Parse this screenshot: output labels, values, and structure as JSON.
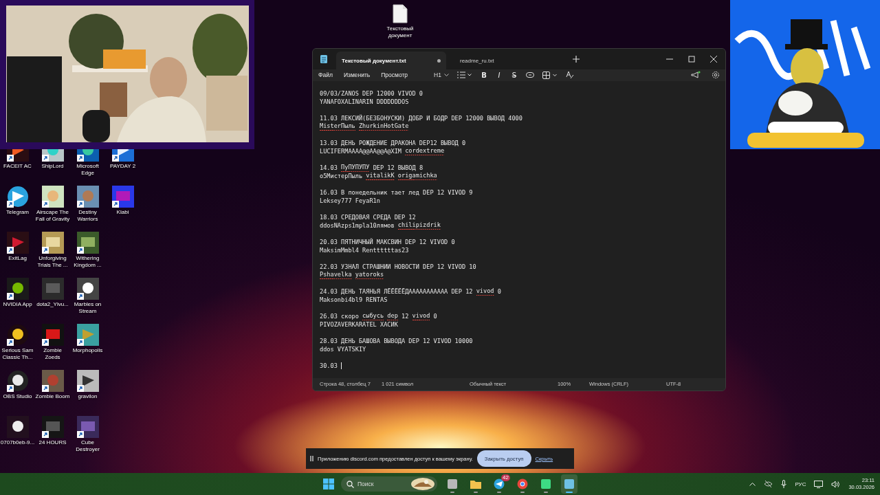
{
  "desktop_file": {
    "label": "Текстовый документ"
  },
  "desktop_icons": [
    {
      "label": "FACEIT AC",
      "kind": "shield",
      "shortcut": true
    },
    {
      "label": "Telegram",
      "kind": "plane",
      "shortcut": true
    },
    {
      "label": "ExitLag",
      "kind": "cross",
      "shortcut": true
    },
    {
      "label": "NVIDIA App",
      "kind": "eye",
      "shortcut": true
    },
    {
      "label": "Serious Sam Classic Th...",
      "kind": "bomb",
      "shortcut": true
    },
    {
      "label": "OBS Studio",
      "kind": "obs",
      "shortcut": true
    },
    {
      "label": "0707b0eb-9...",
      "kind": "dog",
      "shortcut": false
    },
    {
      "label": "ShipLord",
      "kind": "orb",
      "shortcut": true
    },
    {
      "label": "Airscape The Fall of Gravity",
      "kind": "sky",
      "shortcut": true
    },
    {
      "label": "Unforgiving Trials The ...",
      "kind": "sand",
      "shortcut": true
    },
    {
      "label": "dota2_Ylvu...",
      "kind": "thumb",
      "shortcut": false
    },
    {
      "label": "Zombie Zoeds",
      "kind": "zed",
      "shortcut": true
    },
    {
      "label": "Zombie Boom",
      "kind": "crate",
      "shortcut": true
    },
    {
      "label": "24 HOURS",
      "kind": "dark",
      "shortcut": true
    },
    {
      "label": "Microsoft Edge",
      "kind": "wave",
      "shortcut": true
    },
    {
      "label": "Destiny Warriors",
      "kind": "portrait",
      "shortcut": true
    },
    {
      "label": "Withering Kingdom ...",
      "kind": "forest",
      "shortcut": true
    },
    {
      "label": "Marbles on Stream",
      "kind": "marble",
      "shortcut": true
    },
    {
      "label": "Morphopolis",
      "kind": "insect",
      "shortcut": true
    },
    {
      "label": "gravilon",
      "kind": "arrowhead",
      "shortcut": true
    },
    {
      "label": "Cube Destroyer",
      "kind": "cube",
      "shortcut": true
    },
    {
      "label": "PAYDAY 2",
      "kind": "mask",
      "shortcut": true
    },
    {
      "label": "Klabi",
      "kind": "square",
      "shortcut": true
    }
  ],
  "notepad": {
    "tabs": [
      {
        "label": "Текстовый документ.txt",
        "selected": true,
        "unsaved": true
      },
      {
        "label": "readme_ru.txt",
        "selected": false,
        "unsaved": false
      }
    ],
    "menu": [
      "Файл",
      "Изменить",
      "Просмотр"
    ],
    "heading_button": "H1",
    "format_buttons": [
      {
        "kind": "bold",
        "label": "B"
      },
      {
        "kind": "italic",
        "label": "I"
      },
      {
        "kind": "strike",
        "label": "S"
      }
    ],
    "entries": [
      [
        [
          {
            "text": "09/03/ZANOS DEP 12000 VIVOD 0",
            "misspelled": false
          }
        ],
        [
          {
            "text": "YANAFOXALINARIN DDDDDDDOS",
            "misspelled": false
          }
        ]
      ],
      [
        [
          {
            "text": "11.03 ЛЕКСИЙ(БЕЗБОНУСКИ) ДОБР И БОДР DEP 12000 ВЫВОД 4000",
            "misspelled": false
          }
        ],
        [
          {
            "text": "MisterПыль",
            "misspelled": true
          },
          {
            "text": "ZhurkinHotGate",
            "misspelled": true
          }
        ]
      ],
      [
        [
          {
            "text": "13.03 ДЕНЬ РОЖДЕНИЕ ДРАКОНА DEP12 ВЫВОД 0",
            "misspelled": false
          }
        ],
        [
          {
            "text": "LUCIFERMAAAA@@AA@@A@XIM",
            "misspelled": false
          },
          {
            "text": "cordextreme",
            "misspelled": true
          }
        ]
      ],
      [
        [
          {
            "text": "14.03",
            "misspelled": false
          },
          {
            "text": "ПуПУПУПУ",
            "misspelled": true
          },
          {
            "text": "DEP 12 ВЫВОД 8",
            "misspelled": false
          }
        ],
        [
          {
            "text": "o5МистерПыль",
            "misspelled": false
          },
          {
            "text": "vitalikK",
            "misspelled": true
          },
          {
            "text": "origamichka",
            "misspelled": true
          }
        ]
      ],
      [
        [
          {
            "text": "16.03 В понедельник тает лед DEP 12 VIVOD 9",
            "misspelled": false
          }
        ],
        [
          {
            "text": "Leksey777 FeyaR1n",
            "misspelled": false
          }
        ]
      ],
      [
        [
          {
            "text": "18.03 СРЕДОВАЯ СРЕДА DEP 12",
            "misspelled": false
          }
        ],
        [
          {
            "text": "ddosNAzps1mpla10лямов",
            "misspelled": false
          },
          {
            "text": "chilipizdrik",
            "misspelled": true
          }
        ]
      ],
      [
        [
          {
            "text": "20.03 ПЯТНИЧНЫЙ МАКСВИН DEP 12 VIVOD 0",
            "misspelled": false
          }
        ],
        [
          {
            "text": "MaksimMmbl4 Renttttttas23",
            "misspelled": false
          }
        ]
      ],
      [
        [
          {
            "text": "22.03 УЗНАЛ СТРАШНИИ НОВОСТИ DEP 12 VIVOD 10",
            "misspelled": false
          }
        ],
        [
          {
            "text": "Pshavelka",
            "misspelled": true
          },
          {
            "text": "yatoroks",
            "misspelled": true
          }
        ]
      ],
      [
        [
          {
            "text": "24.03 ДЕНЬ ТАЯНЬЯ ЛЁЁЁЁЁДААААААААААА DEP 12",
            "misspelled": false
          },
          {
            "text": "vivod",
            "misspelled": true
          },
          {
            "text": "0",
            "misspelled": false
          }
        ],
        [
          {
            "text": "Maksonbi4bl9 RENTAS",
            "misspelled": false
          }
        ]
      ],
      [
        [
          {
            "text": "26.03 скоро",
            "misspelled": false
          },
          {
            "text": "сыбусь",
            "misspelled": true
          },
          {
            "text": "dep",
            "misspelled": true
          },
          {
            "text": "12",
            "misspelled": false
          },
          {
            "text": "vivod",
            "misspelled": true
          },
          {
            "text": "0",
            "misspelled": false
          }
        ],
        [
          {
            "text": "PIVOZAVERKARATEL ХАСИК",
            "misspelled": false
          }
        ]
      ],
      [
        [
          {
            "text": "28.03 ДЕНЬ БАШОВА ВЫВОДА DEP 12 VIVOD 10000",
            "misspelled": false
          }
        ],
        [
          {
            "text": "ddos VYATSKIY",
            "misspelled": false
          }
        ]
      ],
      [
        [
          {
            "text": "30.03",
            "misspelled": false
          }
        ]
      ]
    ],
    "status_bar": [
      "Строка 48, столбец 7",
      "1 021 символ",
      "Обычный текст",
      "100%",
      "Windows (CRLF)",
      "UTF-8"
    ]
  },
  "toast": {
    "message": "Приложению discord.com предоставлен доступ к вашему экрану.",
    "button": "Закрыть доступ",
    "link": "Скрыть"
  },
  "taskbar": {
    "search_placeholder": "Поиск",
    "apps": [
      {
        "kind": "window",
        "active": false
      },
      {
        "kind": "folder",
        "active": false
      },
      {
        "kind": "plane",
        "active": false,
        "badge": "42"
      },
      {
        "kind": "chrome",
        "active": false
      },
      {
        "kind": "bot",
        "active": false
      },
      {
        "kind": "notepad",
        "active": true
      }
    ],
    "language": "РУС",
    "time": "23:11",
    "date": "30.03.2026"
  }
}
